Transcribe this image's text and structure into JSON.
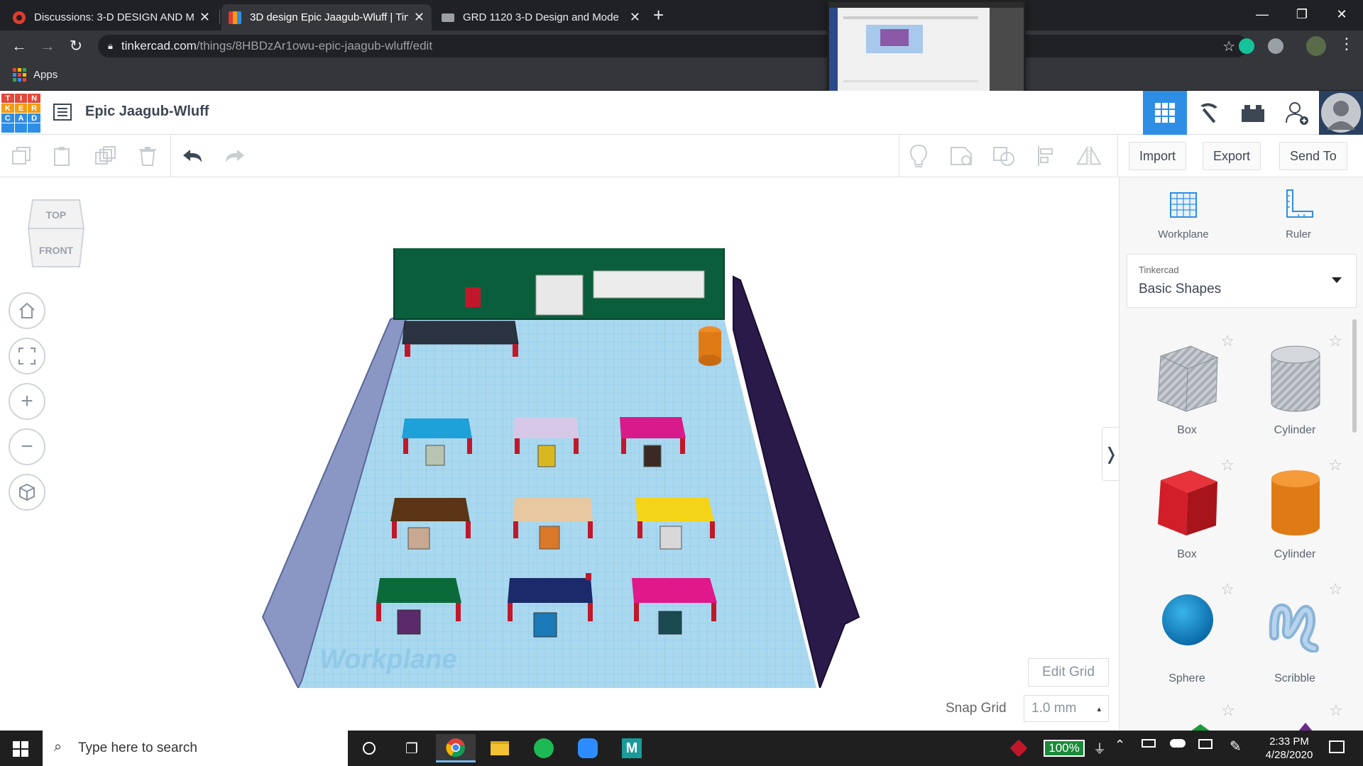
{
  "browser": {
    "tabs": [
      {
        "label": "Discussions: 3-D DESIGN AND M",
        "icon": "canvas-icon"
      },
      {
        "label": "3D design Epic Jaagub-Wluff | Tin",
        "icon": "tinkercad-icon"
      },
      {
        "label": "GRD 1120 3-D Design and Mode",
        "icon": "laptop-icon"
      }
    ],
    "url_host": "tinkercad.com",
    "url_path": "/things/8HBDzAr1owu-epic-jaagub-wluff/edit",
    "bookmark_apps": "Apps"
  },
  "app": {
    "logo_letters": [
      "T",
      "I",
      "N",
      "K",
      "E",
      "R",
      "C",
      "A",
      "D"
    ],
    "design_title": "Epic Jaagub-Wluff",
    "toolbar": {
      "import": "Import",
      "export": "Export",
      "send_to": "Send To"
    },
    "viewcube": {
      "top": "TOP",
      "front": "FRONT"
    },
    "workplane_text": "Workplane",
    "edit_grid": "Edit Grid",
    "snap_grid_label": "Snap Grid",
    "snap_grid_value": "1.0 mm",
    "panel": {
      "workplane": "Workplane",
      "ruler": "Ruler",
      "category_source": "Tinkercad",
      "category": "Basic Shapes",
      "shapes": [
        {
          "label": "Box",
          "style": "striped-box"
        },
        {
          "label": "Cylinder",
          "style": "striped-cylinder"
        },
        {
          "label": "Box",
          "style": "red-box"
        },
        {
          "label": "Cylinder",
          "style": "orange-cylinder"
        },
        {
          "label": "Sphere",
          "style": "blue-sphere"
        },
        {
          "label": "Scribble",
          "style": "scribble"
        }
      ]
    }
  },
  "taskbar": {
    "search_placeholder": "Type here to search",
    "battery": "100%",
    "time": "2:33 PM",
    "date": "4/28/2020"
  },
  "colors": {
    "tinkercad_blue": "#2e8ee6",
    "grid_floor": "#a9d8ef",
    "wall_green": "#0b5e3b",
    "wall_purple": "#2a1a4a",
    "wall_side": "#8a96c4"
  }
}
